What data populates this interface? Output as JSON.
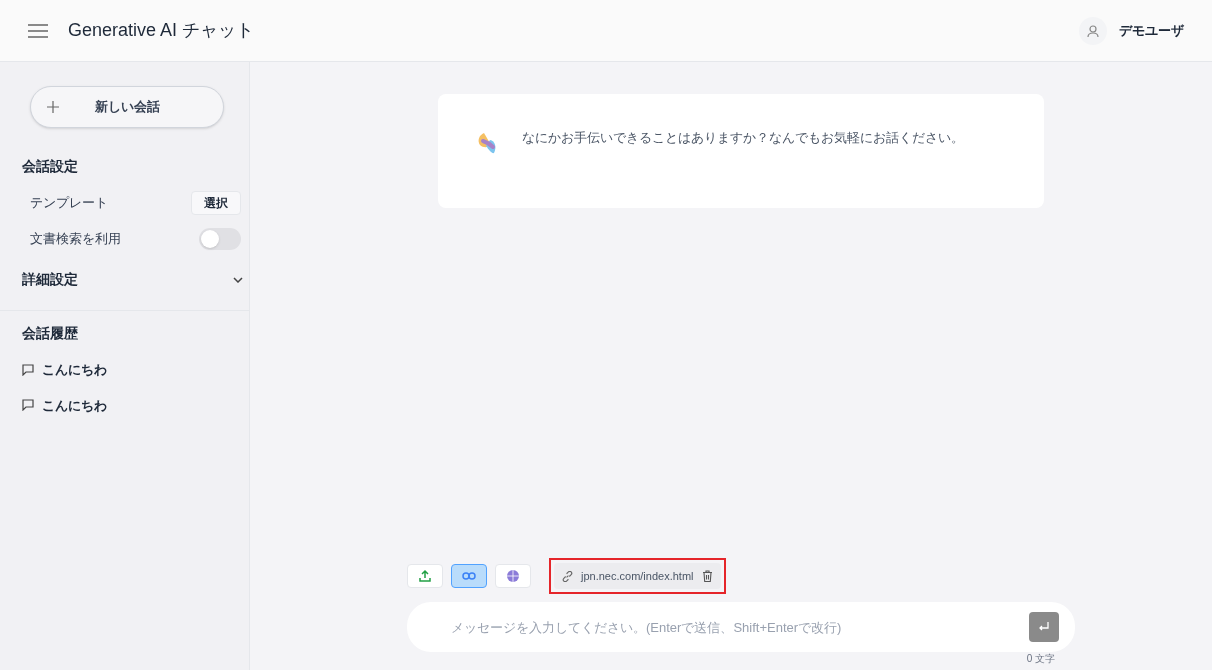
{
  "header": {
    "title": "Generative AI チャット",
    "user": "デモユーザ"
  },
  "sidebar": {
    "new_chat": "新しい会話",
    "settings_title": "会話設定",
    "settings": [
      {
        "kind": "button",
        "label": "テンプレート",
        "button": "選択"
      },
      {
        "kind": "toggle",
        "label": "文書検索を利用",
        "on": false
      }
    ],
    "advanced": {
      "label": "詳細設定",
      "expanded": false
    },
    "history_title": "会話履歴",
    "history": [
      {
        "title": "こんにちわ"
      },
      {
        "title": "こんにちわ"
      }
    ]
  },
  "message": "なにかお手伝いできることはありますか？なんでもお気軽にお話ください。",
  "tools": [
    {
      "kind": "upload",
      "selected": false
    },
    {
      "kind": "link",
      "selected": true
    },
    {
      "kind": "web",
      "selected": false
    }
  ],
  "attachment": {
    "url": "jpn.nec.com/index.html",
    "highlighted": true
  },
  "input": {
    "placeholder": "メッセージを入力してください。(Enterで送信、Shift+Enterで改行)",
    "count": "0 文字"
  }
}
